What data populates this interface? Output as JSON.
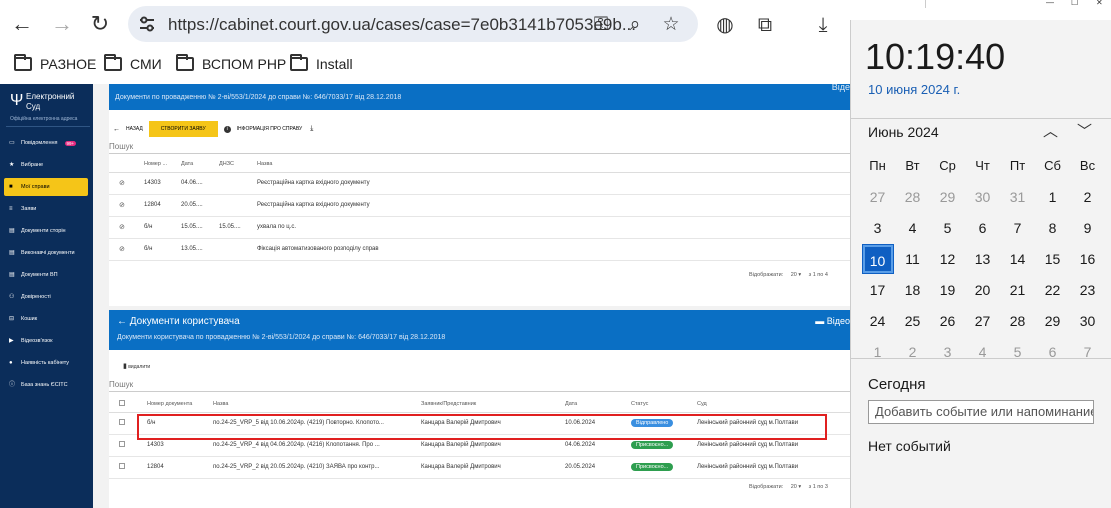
{
  "browser": {
    "url": "https://cabinet.court.gov.ua/cases/case=7e0b3141b7053e9b...",
    "bookmarks": [
      "РАЗНОЕ",
      "СМИ",
      "ВСПОМ PHP",
      "Install"
    ]
  },
  "sidebar": {
    "logo_title": "Електронний Суд",
    "logo_sub": "Офіційна електронна адреса",
    "badge": "99+",
    "items": [
      {
        "label": "Повідомлення",
        "icon": "message-icon"
      },
      {
        "label": "Вибране",
        "icon": "star-icon"
      },
      {
        "label": "Мої справи",
        "icon": "folder-icon",
        "active": true
      },
      {
        "label": "Заяви",
        "icon": "list-icon"
      },
      {
        "label": "Документи сторін",
        "icon": "documents-icon"
      },
      {
        "label": "Виконавчі документи",
        "icon": "documents-icon"
      },
      {
        "label": "Документи ВП",
        "icon": "documents-icon"
      },
      {
        "label": "Довіреності",
        "icon": "people-icon"
      },
      {
        "label": "Кошик",
        "icon": "cart-icon"
      },
      {
        "label": "Відеозв'язок",
        "icon": "video-icon"
      },
      {
        "label": "Наявність кабінету",
        "icon": "person-icon"
      },
      {
        "label": "База знань ЄСІТС",
        "icon": "info-icon"
      }
    ]
  },
  "panel1": {
    "subtitle": "Документи по провадженню № 2-ві/553/1/2024 до справи №: 646/7033/17 від 28.12.2018",
    "video_label": "Віде",
    "back_label": "НАЗАД",
    "create_label": "СТВОРИТИ ЗАЯВУ",
    "info_label": "ІНФОРМАЦІЯ ПРО СПРАВУ",
    "search_placeholder": "Пошук",
    "columns": [
      "Номер ...",
      "Дата",
      "ДНЗС",
      "Назва"
    ],
    "rows": [
      {
        "num": "14303",
        "date": "04.06....",
        "dnzs": "",
        "name": "Реєстраційна картка вхідного документу"
      },
      {
        "num": "12804",
        "date": "20.05....",
        "dnzs": "",
        "name": "Реєстраційна картка вхідного документу"
      },
      {
        "num": "б/н",
        "date": "15.05....",
        "dnzs": "15.05....",
        "name": "ухвала по ц.с."
      },
      {
        "num": "б/н",
        "date": "13.05....",
        "dnzs": "",
        "name": "Фіксація автоматизованого розподілу справ"
      }
    ],
    "pager_label": "Відображати:",
    "pager_size": "20",
    "pager_range": "з 1 по 4"
  },
  "panel2": {
    "title": "Документи користувача",
    "subtitle": "Документи користувача по провадженню № 2-ві/553/1/2024 до справи №: 646/7033/17 від 28.12.2018",
    "video_label": "Відео",
    "delete_label": "видалити",
    "search_placeholder": "Пошук",
    "columns": [
      "Номер документа",
      "Назва",
      "Заявник/Представник",
      "Дата",
      "Статус",
      "Суд"
    ],
    "rows": [
      {
        "num": "б/н",
        "name": "по.24-25_VRP_5 від 10.06.2024р. (4219) Повторно. Клопото...",
        "applicant": "Канцара Валерій Дмитрович",
        "date": "10.06.2024",
        "status": "Відправлено",
        "status_color": "#3a8fe0",
        "court": "Ленінський районний суд м.Полтави"
      },
      {
        "num": "14303",
        "name": "по.24-25_VRP_4 від 04.06.2024р. (4216) Клопотання. Про ...",
        "applicant": "Канцара Валерій Дмитрович",
        "date": "04.06.2024",
        "status": "Присвоєно...",
        "status_color": "#2e9e4f",
        "court": "Ленінський районний суд м.Полтави"
      },
      {
        "num": "12804",
        "name": "по.24-25_VRP_2 від 20.05.2024р. (4210) ЗАЯВА про контр...",
        "applicant": "Канцара Валерій Дмитрович",
        "date": "20.05.2024",
        "status": "Присвоєно...",
        "status_color": "#2e9e4f",
        "court": "Ленінський районний суд м.Полтави"
      }
    ],
    "pager_label": "Відображати:",
    "pager_size": "20",
    "pager_range": "з 1 по 3"
  },
  "flyout": {
    "time": "10:19:40",
    "date": "10 июня 2024 г.",
    "month": "Июнь 2024",
    "weekdays": [
      "Пн",
      "Вт",
      "Ср",
      "Чт",
      "Пт",
      "Сб",
      "Вс"
    ],
    "weeks": [
      [
        "27",
        "28",
        "29",
        "30",
        "31",
        "1",
        "2"
      ],
      [
        "3",
        "4",
        "5",
        "6",
        "7",
        "8",
        "9"
      ],
      [
        "10",
        "11",
        "12",
        "13",
        "14",
        "15",
        "16"
      ],
      [
        "17",
        "18",
        "19",
        "20",
        "21",
        "22",
        "23"
      ],
      [
        "24",
        "25",
        "26",
        "27",
        "28",
        "29",
        "30"
      ],
      [
        "1",
        "2",
        "3",
        "4",
        "5",
        "6",
        "7"
      ]
    ],
    "today_label": "Сегодня",
    "event_placeholder": "Добавить событие или напоминание",
    "no_events": "Нет событий"
  }
}
